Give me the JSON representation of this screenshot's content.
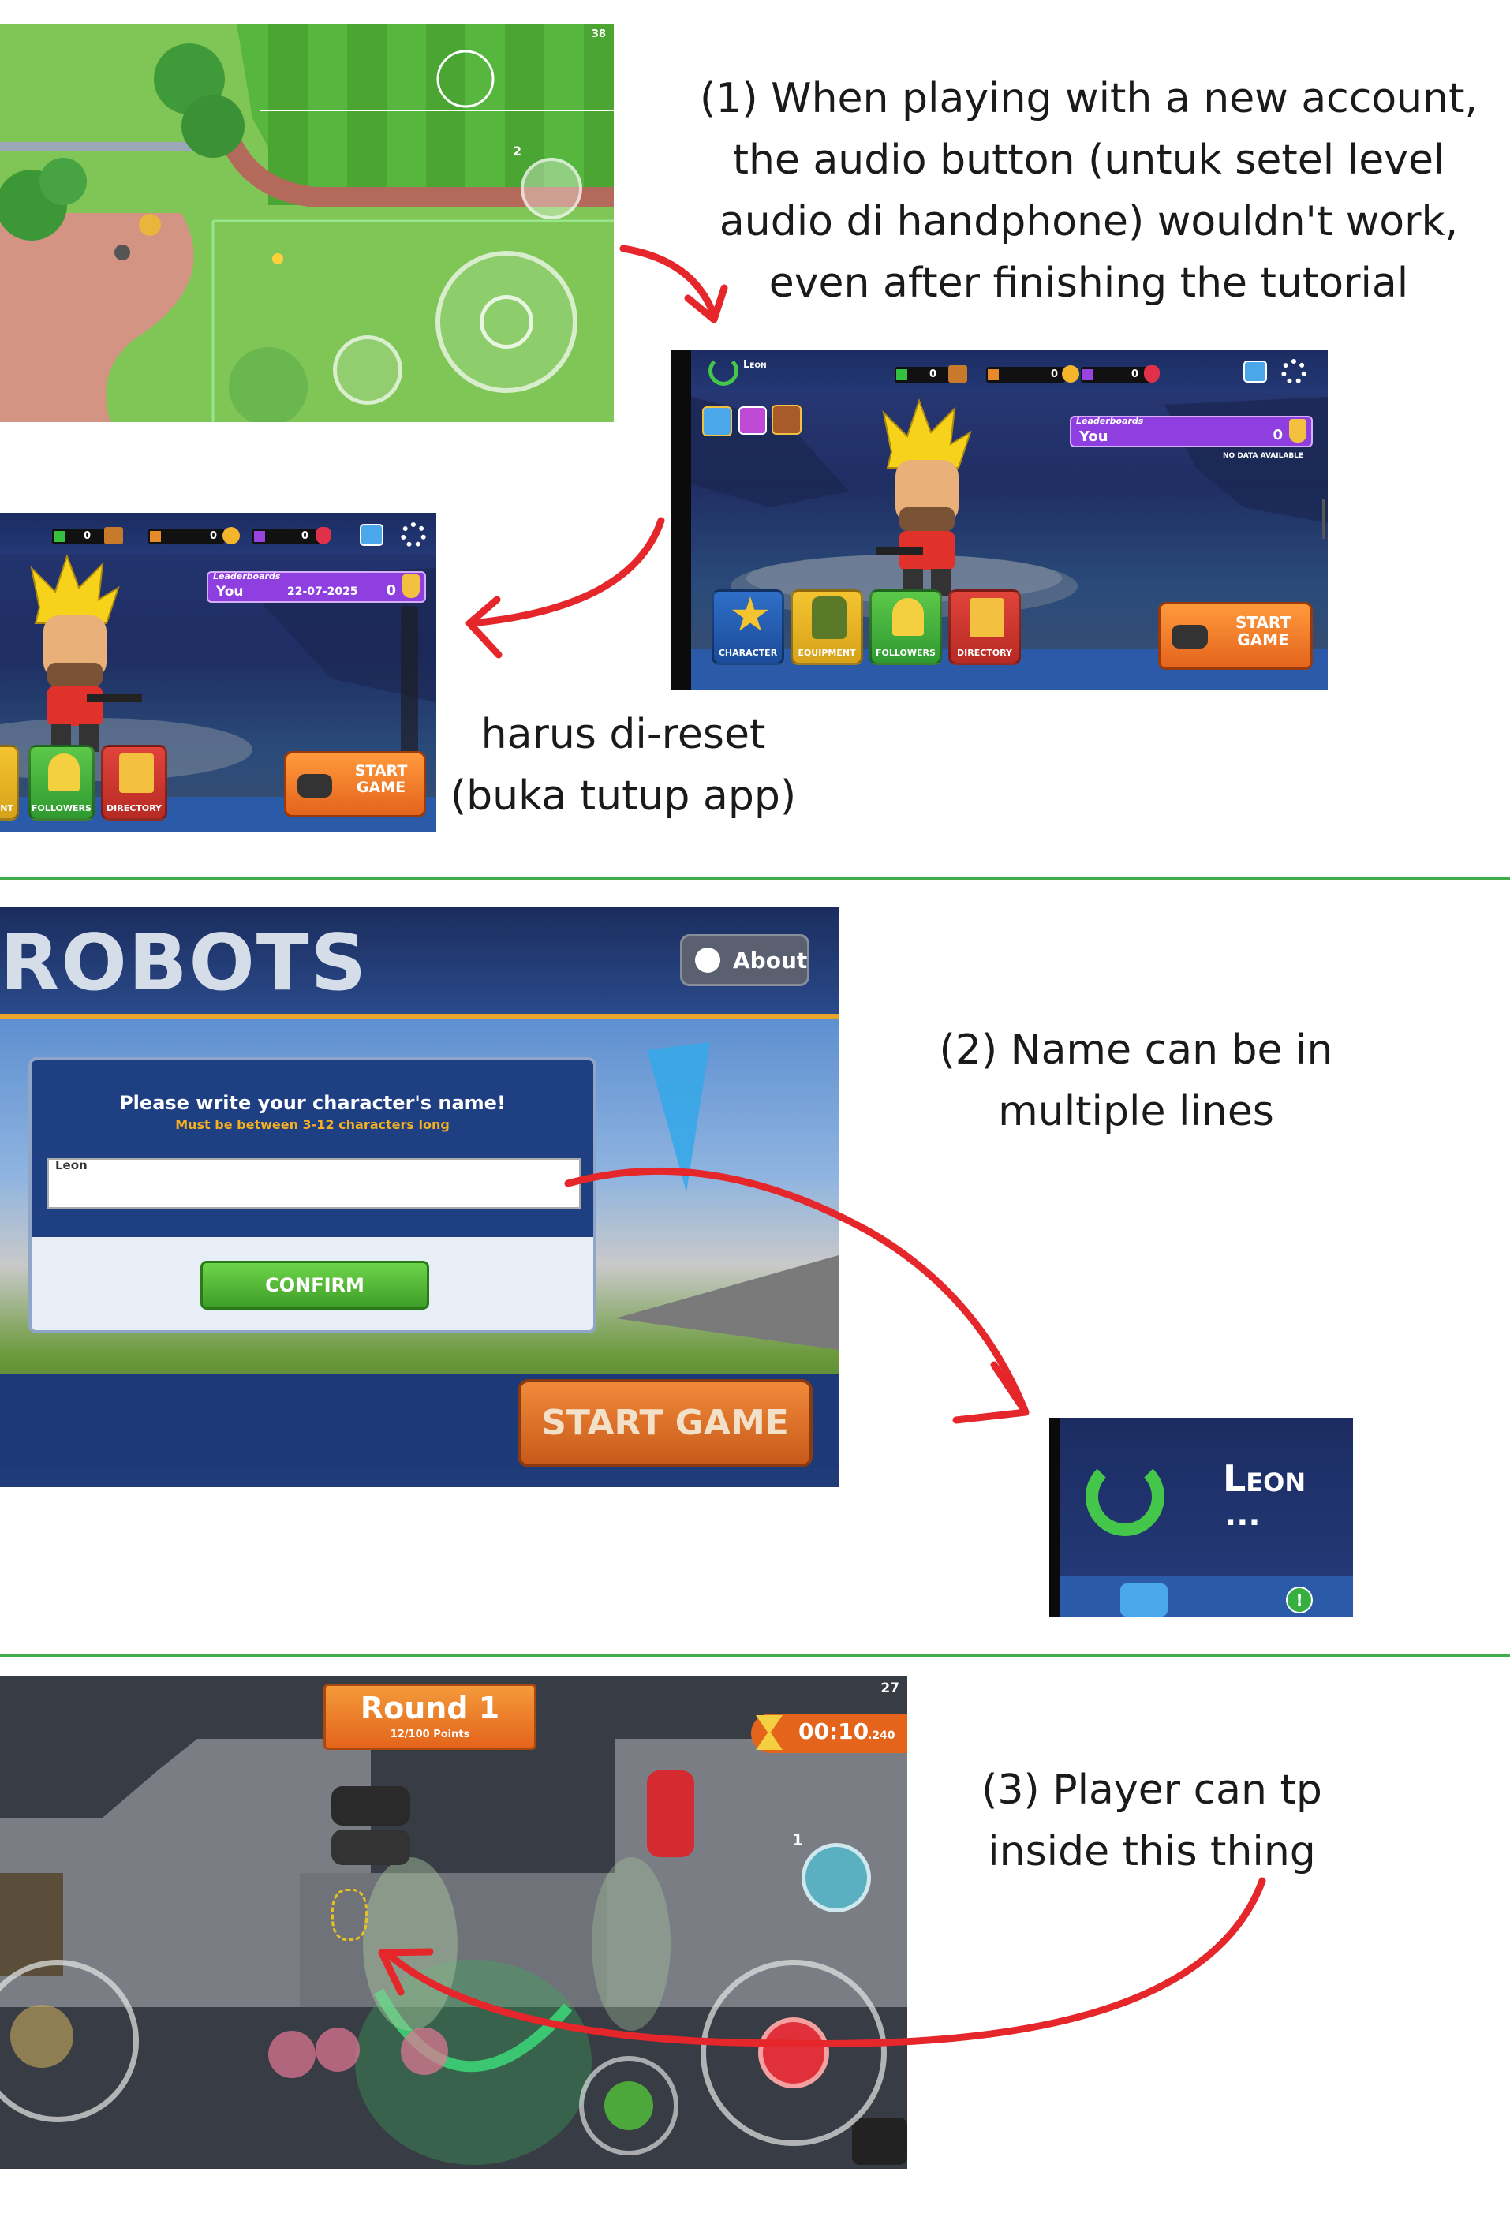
{
  "notes": {
    "n1": [
      "(1) When playing with a new account,",
      "the audio button (untuk setel level",
      "audio di handphone) wouldn't work,",
      "even after finishing the tutorial"
    ],
    "reset": [
      "harus di-reset",
      "(buka tutup app)"
    ],
    "n2": [
      "(2) Name can be in",
      "multiple lines"
    ],
    "n3": [
      "(3) Player can tp",
      "inside this thing"
    ]
  },
  "shot1": {
    "fps": "38",
    "player_count": "2"
  },
  "lobby": {
    "player_name": "Leon",
    "currency_values": [
      "0",
      "0",
      "0"
    ],
    "leaderboard_title": "Leaderboards",
    "leaderboard_you": "You",
    "leaderboard_points": "0",
    "no_data": "NO DATA AVAILABLE",
    "menu": [
      "CHARACTER",
      "EQUIPMENT",
      "FOLLOWERS",
      "DIRECTORY"
    ],
    "start_game": [
      "START",
      "GAME"
    ]
  },
  "lobby2": {
    "currency_values": [
      "0",
      "0",
      "0"
    ],
    "leaderboard_title": "Leaderboards",
    "leaderboard_you": "You",
    "leaderboard_date": "22-07-2025",
    "leaderboard_points": "0",
    "menu": [
      "ENT",
      "FOLLOWERS",
      "DIRECTORY"
    ],
    "start_game": [
      "START",
      "GAME"
    ]
  },
  "naming": {
    "title_partial": "ROBOTS",
    "about": "About",
    "prompt": "Please write your character's name!",
    "rule": "Must be between 3-12 characters long",
    "input_value": "Leon",
    "confirm": "CONFIRM",
    "start_game": "START GAME"
  },
  "name_crop": {
    "name": "Leon",
    "overflow": "..."
  },
  "round": {
    "title": "Round 1",
    "points": "12/100 Points",
    "timer": "00:10",
    "timer_ms": ".240",
    "fps": "27",
    "player_count": "1"
  },
  "colors": {
    "divider": "#3fae49",
    "arrow": "#e5262a",
    "lobby_bg": "#1a2a5e",
    "leaderboard": "#8f3ee0",
    "start_button": "#f07a25",
    "confirm_button": "#4cb82e"
  }
}
